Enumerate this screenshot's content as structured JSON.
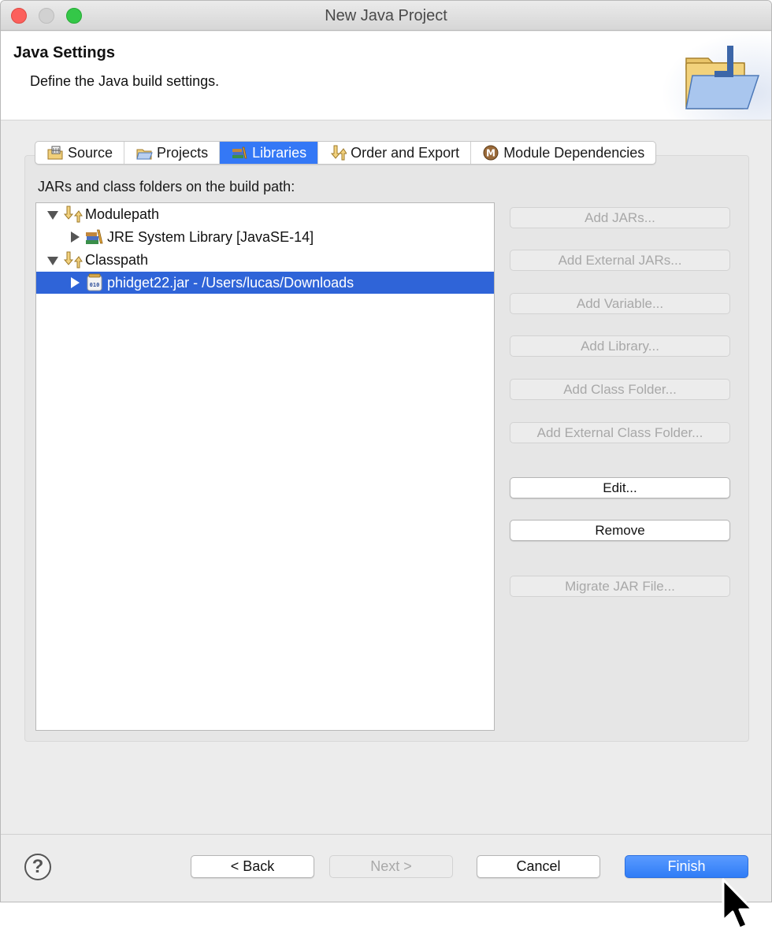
{
  "window": {
    "title": "New Java Project"
  },
  "header": {
    "title": "Java Settings",
    "description": "Define the Java build settings.",
    "icon": "folder-java-icon"
  },
  "tabs": [
    {
      "label": "Source",
      "icon": "source-folder-icon",
      "active": false
    },
    {
      "label": "Projects",
      "icon": "projects-folder-icon",
      "active": false
    },
    {
      "label": "Libraries",
      "icon": "libraries-icon",
      "active": true
    },
    {
      "label": "Order and Export",
      "icon": "order-export-icon",
      "active": false
    },
    {
      "label": "Module Dependencies",
      "icon": "module-icon",
      "active": false
    }
  ],
  "libraries": {
    "list_label": "JARs and class folders on the build path:",
    "tree": [
      {
        "label": "Modulepath",
        "expanded": true,
        "icon": "buildpath-icon"
      },
      {
        "label": "JRE System Library [JavaSE-14]",
        "expanded": false,
        "icon": "library-books-icon"
      },
      {
        "label": "Classpath",
        "expanded": true,
        "icon": "buildpath-icon"
      },
      {
        "label": "phidget22.jar - /Users/lucas/Downloads",
        "expanded": false,
        "icon": "jar-file-icon",
        "selected": true
      }
    ],
    "buttons": [
      {
        "label": "Add JARs...",
        "enabled": false
      },
      {
        "label": "Add External JARs...",
        "enabled": false
      },
      {
        "label": "Add Variable...",
        "enabled": false
      },
      {
        "label": "Add Library...",
        "enabled": false
      },
      {
        "label": "Add Class Folder...",
        "enabled": false
      },
      {
        "label": "Add External Class Folder...",
        "enabled": false
      },
      {
        "label": "Edit...",
        "enabled": true
      },
      {
        "label": "Remove",
        "enabled": true
      },
      {
        "label": "Migrate JAR File...",
        "enabled": false
      }
    ]
  },
  "footer": {
    "help": "?",
    "back": "< Back",
    "next": "Next >",
    "cancel": "Cancel",
    "finish": "Finish"
  },
  "colors": {
    "accent": "#3478f6",
    "selection": "#2f64d8"
  }
}
